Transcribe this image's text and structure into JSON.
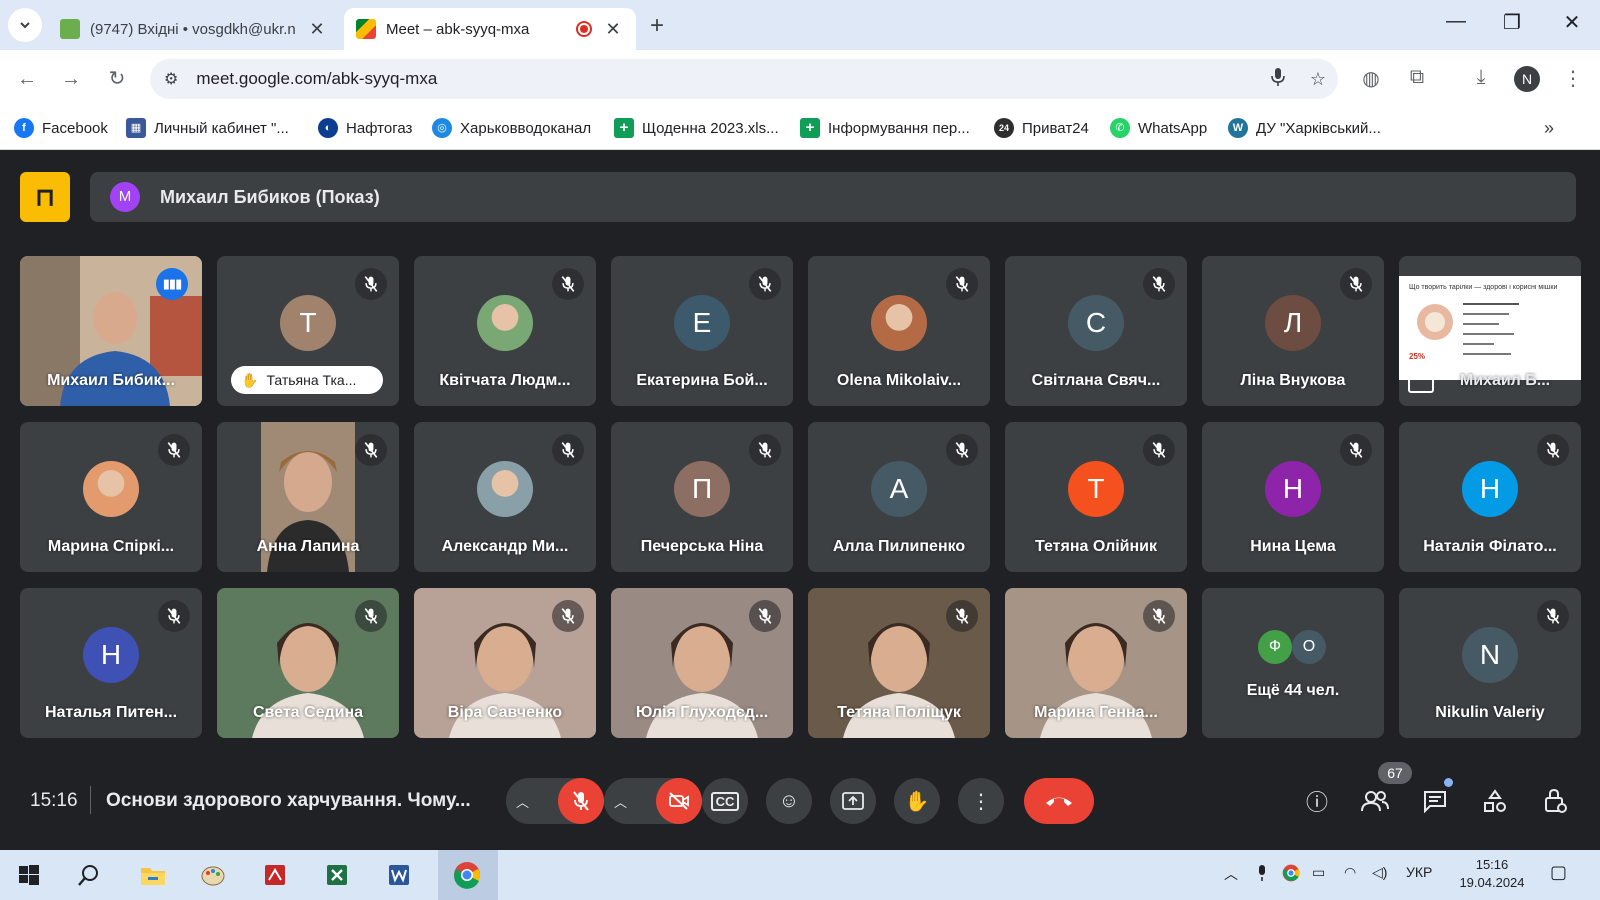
{
  "browser": {
    "tabs": [
      {
        "label": "(9747) Вхідні • vosgdkh@ukr.n",
        "active": false
      },
      {
        "label": "Meet – abk-syyq-mxa",
        "active": true
      }
    ],
    "url": "meet.google.com/abk-syyq-mxa",
    "profile_initial": "N",
    "bookmarks": [
      {
        "label": "Facebook",
        "color": "#1877f2",
        "glyph": "f"
      },
      {
        "label": "Личный кабинет \"...",
        "color": "#3b5998",
        "glyph": "▦"
      },
      {
        "label": "Нафтогаз",
        "color": "#0b3d91",
        "glyph": "◐"
      },
      {
        "label": "Харьковводоканал",
        "color": "#1e88e5",
        "glyph": "◎"
      },
      {
        "label": "Щоденна 2023.xls...",
        "color": "#0f9d58",
        "glyph": "+"
      },
      {
        "label": "Інформування пер...",
        "color": "#0f9d58",
        "glyph": "+"
      },
      {
        "label": "Приват24",
        "color": "#2e2e2e",
        "glyph": "24"
      },
      {
        "label": "WhatsApp",
        "color": "#25d366",
        "glyph": "✆"
      },
      {
        "label": "ДУ \"Харківський...",
        "color": "#21759b",
        "glyph": "W"
      }
    ]
  },
  "meet": {
    "presenter_initial": "М",
    "presenter_label": "Михаил Бибиков (Показ)",
    "participants": [
      {
        "name": "Михаил Бибик...",
        "type": "video",
        "speaking": true
      },
      {
        "name": "Татьяна Тка...",
        "type": "avatar",
        "initial": "Т",
        "color": "#a0826d",
        "hand": true
      },
      {
        "name": "Квітчата Людм...",
        "type": "photo",
        "color": "#7aa874"
      },
      {
        "name": "Екатерина Бой...",
        "type": "avatar",
        "initial": "Е",
        "color": "#3d5a6c"
      },
      {
        "name": "Olena Mikolaiv...",
        "type": "photo",
        "color": "#b46a45"
      },
      {
        "name": "Світлана Свяч...",
        "type": "avatar",
        "initial": "С",
        "color": "#455a64"
      },
      {
        "name": "Ліна Внукова",
        "type": "avatar",
        "initial": "Л",
        "color": "#6d4c41"
      },
      {
        "name": "Михаил Б...",
        "type": "screen"
      },
      {
        "name": "Марина Спіркі...",
        "type": "photo",
        "color": "#e39a6c"
      },
      {
        "name": "Анна Лапина",
        "type": "video2",
        "color": "#a08a76"
      },
      {
        "name": "Александр Ми...",
        "type": "photo",
        "color": "#8aa0a8"
      },
      {
        "name": "Печерська Ніна",
        "type": "avatar",
        "initial": "П",
        "color": "#8d6e63"
      },
      {
        "name": "Алла Пилипенко",
        "type": "avatar",
        "initial": "А",
        "color": "#455a64"
      },
      {
        "name": "Тетяна Олійник",
        "type": "avatar",
        "initial": "Т",
        "color": "#f4511e"
      },
      {
        "name": "Нина Цема",
        "type": "avatar",
        "initial": "Н",
        "color": "#8e24aa"
      },
      {
        "name": "Наталія Філато...",
        "type": "avatar",
        "initial": "Н",
        "color": "#039be5"
      },
      {
        "name": "Наталья Питен...",
        "type": "avatar",
        "initial": "Н",
        "color": "#3f51b5"
      },
      {
        "name": "Света Седина",
        "type": "video",
        "color": "#5e7a5e"
      },
      {
        "name": "Віра Савченко",
        "type": "video",
        "color": "#b8a196"
      },
      {
        "name": "Юлія Глуходєд...",
        "type": "video",
        "color": "#9a8a84"
      },
      {
        "name": "Тетяна Поліщук",
        "type": "video",
        "color": "#6a5a4a"
      },
      {
        "name": "Марина Генна...",
        "type": "video",
        "color": "#a69486"
      },
      {
        "name": "Ещё 44 чел.",
        "type": "more",
        "mini": [
          {
            "initial": "Ф",
            "color": "#43a047"
          },
          {
            "initial": "О",
            "color": "#455a64"
          }
        ]
      },
      {
        "name": "Nikulin Valeriy",
        "type": "avatar",
        "initial": "N",
        "color": "#455a64"
      }
    ],
    "slide_title": "Що творить тарілки — здорові і корисні мішки",
    "slide_pct": "25%"
  },
  "controls": {
    "time": "15:16",
    "meeting_title": "Основи здорового харчування. Чому...",
    "people_count": "67"
  },
  "taskbar": {
    "lang": "УКР",
    "time": "15:16",
    "date": "19.04.2024"
  }
}
